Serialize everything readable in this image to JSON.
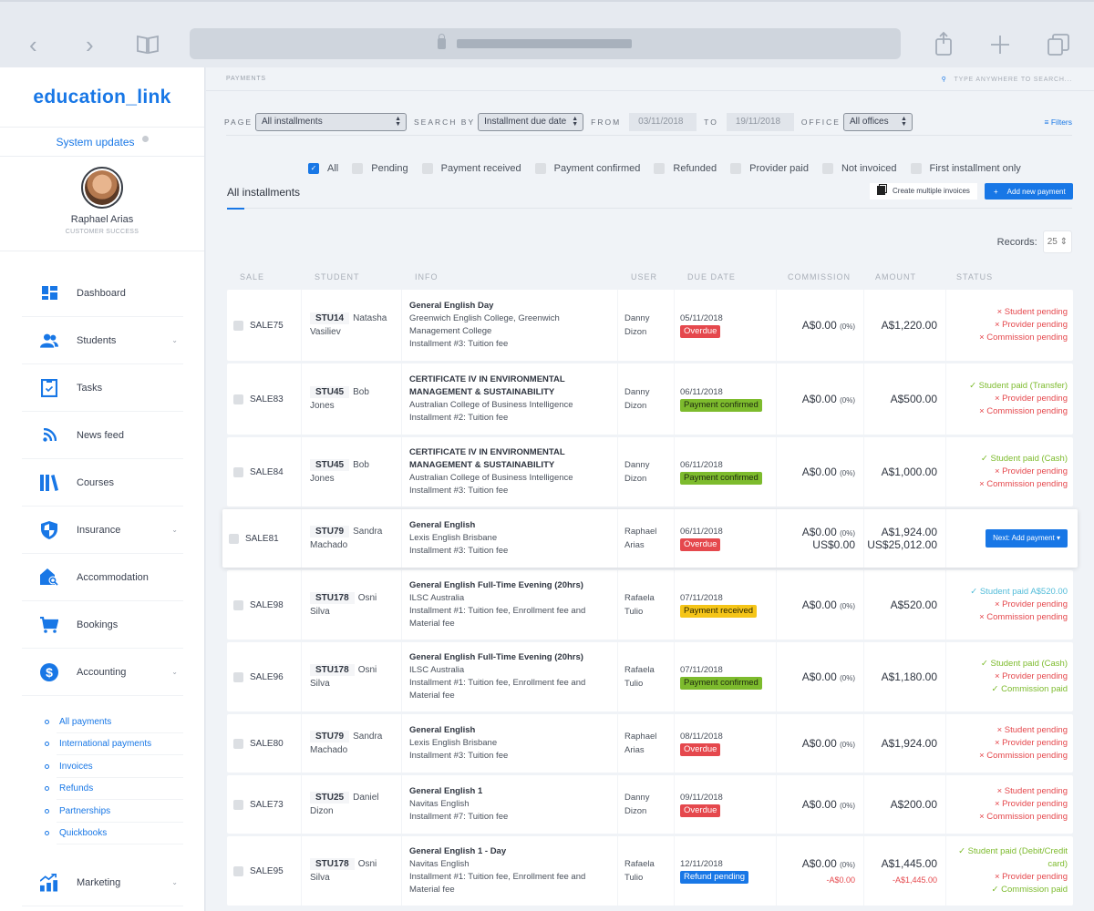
{
  "browser": {
    "back_icon": "‹",
    "forward_icon": "›"
  },
  "sidebar": {
    "logo": "education_link",
    "system_updates": "System updates",
    "profile": {
      "name": "Raphael Arias",
      "role": "CUSTOMER SUCCESS"
    },
    "items": [
      {
        "label": "Dashboard",
        "icon": "dashboard-icon",
        "expandable": false
      },
      {
        "label": "Students",
        "icon": "students-icon",
        "expandable": true
      },
      {
        "label": "Tasks",
        "icon": "tasks-icon",
        "expandable": false
      },
      {
        "label": "News feed",
        "icon": "rss-icon",
        "expandable": false
      },
      {
        "label": "Courses",
        "icon": "courses-icon",
        "expandable": false
      },
      {
        "label": "Insurance",
        "icon": "shield-icon",
        "expandable": true
      },
      {
        "label": "Accommodation",
        "icon": "house-search-icon",
        "expandable": false
      },
      {
        "label": "Bookings",
        "icon": "cart-icon",
        "expandable": false
      },
      {
        "label": "Accounting",
        "icon": "dollar-icon",
        "expandable": true
      }
    ],
    "accounting_sub": [
      "All payments",
      "International payments",
      "Invoices",
      "Refunds",
      "Partnerships",
      "Quickbooks"
    ],
    "marketing": {
      "label": "Marketing",
      "icon": "chart-up-icon"
    }
  },
  "topbar": {
    "breadcrumb": "PAYMENTS",
    "search_placeholder": "TYPE ANYWHERE TO SEARCH..."
  },
  "filters": {
    "page_label": "PAGE",
    "page_value": "All installments",
    "search_by_label": "SEARCH BY",
    "search_by_value": "Installment due date",
    "from_label": "FROM",
    "from_value": "03/11/2018",
    "to_label": "TO",
    "to_value": "19/11/2018",
    "office_label": "OFFICE",
    "office_value": "All offices",
    "filters_button": "Filters"
  },
  "status_checks": [
    {
      "label": "All",
      "checked": true
    },
    {
      "label": "Pending",
      "checked": false
    },
    {
      "label": "Payment received",
      "checked": false
    },
    {
      "label": "Payment confirmed",
      "checked": false
    },
    {
      "label": "Refunded",
      "checked": false
    },
    {
      "label": "Provider paid",
      "checked": false
    },
    {
      "label": "Not invoiced",
      "checked": false
    },
    {
      "label": "First installment only",
      "checked": false
    }
  ],
  "tab_title": "All installments",
  "actions": {
    "create_invoices": "Create multiple invoices",
    "add_payment": "Add new payment"
  },
  "records": {
    "label": "Records:",
    "value": "25"
  },
  "table": {
    "columns": [
      "SALE",
      "STUDENT",
      "INFO",
      "USER",
      "DUE DATE",
      "COMMISSION",
      "AMOUNT",
      "STATUS"
    ],
    "rows": [
      {
        "sale": "SALE75",
        "stu": "STU14",
        "student": "Natasha Vasiliev",
        "title": "General English Day",
        "provider": "Greenwich English College, Greenwich Management College",
        "installment": "Installment #3: Tuition fee",
        "user": "Danny Dizon",
        "due": "05/11/2018",
        "badge": "Overdue",
        "badge_color": "#e5484d",
        "badge_text": "#fff",
        "commission": "A$0.00",
        "commission_pct": "(0%)",
        "amount": "A$1,220.00",
        "status": [
          {
            "t": "× Student pending",
            "c": "red"
          },
          {
            "t": "× Provider pending",
            "c": "red"
          },
          {
            "t": "× Commission pending",
            "c": "red"
          }
        ]
      },
      {
        "sale": "SALE83",
        "stu": "STU45",
        "student": "Bob Jones",
        "title": "CERTIFICATE IV IN ENVIRONMENTAL MANAGEMENT & SUSTAINABILITY",
        "provider": "Australian College of Business Intelligence",
        "installment": "Installment #2: Tuition fee",
        "user": "Danny Dizon",
        "due": "06/11/2018",
        "badge": "Payment confirmed",
        "badge_color": "#7dbb2d",
        "badge_text": "#1f2a10",
        "commission": "A$0.00",
        "commission_pct": "(0%)",
        "amount": "A$500.00",
        "status": [
          {
            "t": "✓ Student paid (Transfer)",
            "c": "green"
          },
          {
            "t": "× Provider pending",
            "c": "red"
          },
          {
            "t": "× Commission pending",
            "c": "red"
          }
        ]
      },
      {
        "sale": "SALE84",
        "stu": "STU45",
        "student": "Bob Jones",
        "title": "CERTIFICATE IV IN ENVIRONMENTAL MANAGEMENT & SUSTAINABILITY",
        "provider": "Australian College of Business Intelligence",
        "installment": "Installment #3: Tuition fee",
        "user": "Danny Dizon",
        "due": "06/11/2018",
        "badge": "Payment confirmed",
        "badge_color": "#7dbb2d",
        "badge_text": "#1f2a10",
        "commission": "A$0.00",
        "commission_pct": "(0%)",
        "amount": "A$1,000.00",
        "status": [
          {
            "t": "✓ Student paid (Cash)",
            "c": "green"
          },
          {
            "t": "× Provider pending",
            "c": "red"
          },
          {
            "t": "× Commission pending",
            "c": "red"
          }
        ]
      },
      {
        "sale": "SALE81",
        "stu": "STU79",
        "student": "Sandra Machado",
        "title": "General English",
        "provider": "Lexis English Brisbane",
        "installment": "Installment #3: Tuition fee",
        "user": "Raphael Arias",
        "due": "06/11/2018",
        "badge": "Overdue",
        "badge_color": "#e5484d",
        "badge_text": "#fff",
        "commission": "A$0.00",
        "commission_pct": "(0%)",
        "commission2": "US$0.00",
        "amount": "A$1,924.00",
        "amount2": "US$25,012.00",
        "next_button": "Next: Add payment ▾",
        "highlight": true,
        "status": []
      },
      {
        "sale": "SALE98",
        "stu": "STU178",
        "student": "Osni Silva",
        "title": "General English Full-Time Evening (20hrs)",
        "provider": "ILSC Australia",
        "installment": "Installment #1: Tuition fee, Enrollment fee and Material fee",
        "user": "Rafaela Tulio",
        "due": "07/11/2018",
        "badge": "Payment received",
        "badge_color": "#f5c518",
        "badge_text": "#2a2400",
        "commission": "A$0.00",
        "commission_pct": "(0%)",
        "amount": "A$520.00",
        "status": [
          {
            "t": "✓ Student paid A$520.00",
            "c": "teal"
          },
          {
            "t": "× Provider pending",
            "c": "red"
          },
          {
            "t": "× Commission pending",
            "c": "red"
          }
        ]
      },
      {
        "sale": "SALE96",
        "stu": "STU178",
        "student": "Osni Silva",
        "title": "General English Full-Time Evening (20hrs)",
        "provider": "ILSC Australia",
        "installment": "Installment #1: Tuition fee, Enrollment fee and Material fee",
        "user": "Rafaela Tulio",
        "due": "07/11/2018",
        "badge": "Payment confirmed",
        "badge_color": "#7dbb2d",
        "badge_text": "#1f2a10",
        "commission": "A$0.00",
        "commission_pct": "(0%)",
        "amount": "A$1,180.00",
        "status": [
          {
            "t": "✓ Student paid (Cash)",
            "c": "green"
          },
          {
            "t": "× Provider pending",
            "c": "red"
          },
          {
            "t": "✓ Commission paid",
            "c": "green"
          }
        ]
      },
      {
        "sale": "SALE80",
        "stu": "STU79",
        "student": "Sandra Machado",
        "title": "General English",
        "provider": "Lexis English Brisbane",
        "installment": "Installment #3: Tuition fee",
        "user": "Raphael Arias",
        "due": "08/11/2018",
        "badge": "Overdue",
        "badge_color": "#e5484d",
        "badge_text": "#fff",
        "commission": "A$0.00",
        "commission_pct": "(0%)",
        "amount": "A$1,924.00",
        "status": [
          {
            "t": "× Student pending",
            "c": "red"
          },
          {
            "t": "× Provider pending",
            "c": "red"
          },
          {
            "t": "× Commission pending",
            "c": "red"
          }
        ]
      },
      {
        "sale": "SALE73",
        "stu": "STU25",
        "student": "Daniel Dizon",
        "title": "General English 1",
        "provider": "Navitas English",
        "installment": "Installment #7: Tuition fee",
        "user": "Danny Dizon",
        "due": "09/11/2018",
        "badge": "Overdue",
        "badge_color": "#e5484d",
        "badge_text": "#fff",
        "commission": "A$0.00",
        "commission_pct": "(0%)",
        "amount": "A$200.00",
        "status": [
          {
            "t": "× Student pending",
            "c": "red"
          },
          {
            "t": "× Provider pending",
            "c": "red"
          },
          {
            "t": "× Commission pending",
            "c": "red"
          }
        ]
      },
      {
        "sale": "SALE95",
        "stu": "STU178",
        "student": "Osni Silva",
        "title": "General English 1 - Day",
        "provider": "Navitas English",
        "installment": "Installment #1: Tuition fee, Enrollment fee and Material fee",
        "user": "Rafaela Tulio",
        "due": "12/11/2018",
        "badge": "Refund pending",
        "badge_color": "#1877e6",
        "badge_text": "#fff",
        "commission": "A$0.00",
        "commission_pct": "(0%)",
        "commission_neg": "-A$0.00",
        "amount": "A$1,445.00",
        "amount_neg": "-A$1,445.00",
        "status": [
          {
            "t": "✓ Student paid (Debit/Credit card)",
            "c": "green"
          },
          {
            "t": "× Provider pending",
            "c": "red"
          },
          {
            "t": "✓ Commission paid",
            "c": "green"
          }
        ]
      }
    ]
  },
  "colors": {
    "accent": "#1877e6",
    "danger": "#e5484d",
    "success": "#7dbb2d",
    "warning": "#f5c518",
    "info": "#52bcd9"
  }
}
